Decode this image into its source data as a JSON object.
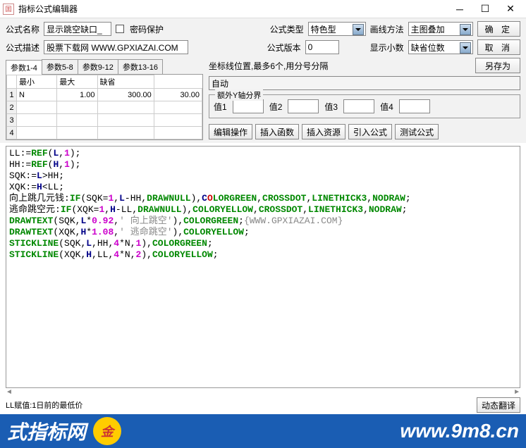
{
  "window": {
    "title": "指标公式编辑器"
  },
  "form": {
    "name_label": "公式名称",
    "name_value": "显示跳空缺口_",
    "pwd_label": "密码保护",
    "type_label": "公式类型",
    "type_value": "特色型",
    "draw_label": "画线方法",
    "draw_value": "主图叠加",
    "desc_label": "公式描述",
    "desc_value": "股票下载网 WWW.GPXIAZAI.COM",
    "ver_label": "公式版本",
    "ver_value": "0",
    "dec_label": "显示小数",
    "dec_value": "缺省位数"
  },
  "buttons": {
    "ok": "确  定",
    "cancel": "取  消",
    "saveas": "另存为",
    "edit_op": "编辑操作",
    "ins_func": "插入函数",
    "ins_res": "插入资源",
    "import": "引入公式",
    "test": "测试公式",
    "auto_trans": "动态翻译"
  },
  "tabs": [
    "参数1-4",
    "参数5-8",
    "参数9-12",
    "参数13-16"
  ],
  "param_headers": [
    "",
    "最小",
    "最大",
    "缺省"
  ],
  "param_rows": [
    {
      "idx": "1",
      "name": "N",
      "min": "1.00",
      "max": "300.00",
      "def": "30.00"
    },
    {
      "idx": "2",
      "name": "",
      "min": "",
      "max": "",
      "def": ""
    },
    {
      "idx": "3",
      "name": "",
      "min": "",
      "max": "",
      "def": ""
    },
    {
      "idx": "4",
      "name": "",
      "min": "",
      "max": "",
      "def": ""
    }
  ],
  "coord": {
    "label": "坐标线位置,最多6个,用分号分隔",
    "value": "自动"
  },
  "extra_y": {
    "legend": "额外Y轴分界",
    "labels": [
      "值1",
      "值2",
      "值3",
      "值4"
    ]
  },
  "code": [
    [
      [
        "LL",
        ""
      ],
      [
        ":=",
        "op"
      ],
      [
        "REF",
        "fn"
      ],
      [
        "(",
        "op"
      ],
      [
        "L",
        "kw"
      ],
      [
        ",",
        "op"
      ],
      [
        "1",
        "num"
      ],
      [
        ");",
        "op"
      ]
    ],
    [
      [
        "HH",
        ""
      ],
      [
        ":=",
        "op"
      ],
      [
        "REF",
        "fn"
      ],
      [
        "(",
        "op"
      ],
      [
        "H",
        "kw"
      ],
      [
        ",",
        "op"
      ],
      [
        "1",
        "num"
      ],
      [
        ");",
        "op"
      ]
    ],
    [
      [
        "SQK",
        ""
      ],
      [
        ":=",
        "op"
      ],
      [
        "L",
        "kw"
      ],
      [
        ">",
        "op"
      ],
      [
        "HH",
        ""
      ],
      [
        ";",
        "op"
      ]
    ],
    [
      [
        "XQK",
        ""
      ],
      [
        ":=",
        "op"
      ],
      [
        "H",
        "kw"
      ],
      [
        "<",
        "op"
      ],
      [
        "LL",
        ""
      ],
      [
        ";",
        "op"
      ]
    ],
    [
      [
        "向上跳几元钱",
        ""
      ],
      [
        ":",
        "op"
      ],
      [
        "IF",
        "fn"
      ],
      [
        "(",
        "op"
      ],
      [
        "SQK",
        ""
      ],
      [
        "=",
        "op"
      ],
      [
        "1",
        "num"
      ],
      [
        ",",
        "op"
      ],
      [
        "L",
        "kw"
      ],
      [
        "-",
        "op"
      ],
      [
        "HH",
        ""
      ],
      [
        ",",
        "op"
      ],
      [
        "DRAWNULL",
        "fn"
      ],
      [
        "),",
        "op"
      ],
      [
        "C",
        "kw"
      ],
      [
        "O",
        "red"
      ],
      [
        "LORGREEN",
        "fn"
      ],
      [
        ",",
        "op"
      ],
      [
        "CROSSDOT",
        "fn"
      ],
      [
        ",",
        "op"
      ],
      [
        "LINETHICK3",
        "fn"
      ],
      [
        ",",
        "op"
      ],
      [
        "NODRAW",
        "fn"
      ],
      [
        ";",
        "op"
      ]
    ],
    [
      [
        "逃命跳空元",
        ""
      ],
      [
        ":",
        "op"
      ],
      [
        "IF",
        "fn"
      ],
      [
        "(",
        "op"
      ],
      [
        "XQK",
        ""
      ],
      [
        "=",
        "op"
      ],
      [
        "1",
        "num"
      ],
      [
        ",",
        "op"
      ],
      [
        "H",
        "kw"
      ],
      [
        "-",
        "op"
      ],
      [
        "LL",
        ""
      ],
      [
        ",",
        "op"
      ],
      [
        "DRAWNULL",
        "fn"
      ],
      [
        "),",
        "op"
      ],
      [
        "COLORYELLOW",
        "fn"
      ],
      [
        ",",
        "op"
      ],
      [
        "CROSSDOT",
        "fn"
      ],
      [
        ",",
        "op"
      ],
      [
        "LINETHICK3",
        "fn"
      ],
      [
        ",",
        "op"
      ],
      [
        "NODRAW",
        "fn"
      ],
      [
        ";",
        "op"
      ]
    ],
    [
      [
        "DRAWTEXT",
        "fn"
      ],
      [
        "(",
        "op"
      ],
      [
        "SQK",
        ""
      ],
      [
        ",",
        "op"
      ],
      [
        "L",
        "kw"
      ],
      [
        "*",
        "op"
      ],
      [
        "0.92",
        "num"
      ],
      [
        ",",
        "op"
      ],
      [
        "' 向上跳空'",
        "str"
      ],
      [
        "),",
        "op"
      ],
      [
        "COLORGREEN",
        "fn"
      ],
      [
        ";",
        "op"
      ],
      [
        "{WWW.GPXIAZAI.COM}",
        "comment"
      ]
    ],
    [
      [
        "DRAWTEXT",
        "fn"
      ],
      [
        "(",
        "op"
      ],
      [
        "XQK",
        ""
      ],
      [
        ",",
        "op"
      ],
      [
        "H",
        "kw"
      ],
      [
        "*",
        "op"
      ],
      [
        "1.08",
        "num"
      ],
      [
        ",",
        "op"
      ],
      [
        "' 逃命跳空'",
        "str"
      ],
      [
        "),",
        "op"
      ],
      [
        "COLORYELLOW",
        "fn"
      ],
      [
        ";",
        "op"
      ]
    ],
    [
      [
        "STICKLINE",
        "fn"
      ],
      [
        "(",
        "op"
      ],
      [
        "SQK",
        ""
      ],
      [
        ",",
        "op"
      ],
      [
        "L",
        "kw"
      ],
      [
        ",",
        "op"
      ],
      [
        "HH",
        ""
      ],
      [
        ",",
        "op"
      ],
      [
        "4",
        "num"
      ],
      [
        "*",
        "op"
      ],
      [
        "N",
        ""
      ],
      [
        ",",
        "op"
      ],
      [
        "1",
        "num"
      ],
      [
        "),",
        "op"
      ],
      [
        "COLORGREEN",
        "fn"
      ],
      [
        ";",
        "op"
      ]
    ],
    [
      [
        "STICKLINE",
        "fn"
      ],
      [
        "(",
        "op"
      ],
      [
        "XQK",
        ""
      ],
      [
        ",",
        "op"
      ],
      [
        "H",
        "kw"
      ],
      [
        ",",
        "op"
      ],
      [
        "LL",
        ""
      ],
      [
        ",",
        "op"
      ],
      [
        "4",
        "num"
      ],
      [
        "*",
        "op"
      ],
      [
        "N",
        ""
      ],
      [
        ",",
        "op"
      ],
      [
        "2",
        "num"
      ],
      [
        "),",
        "op"
      ],
      [
        "COLORYELLOW",
        "fn"
      ],
      [
        ";",
        "op"
      ]
    ]
  ],
  "status": "LL赋值:1日前的最低价",
  "banner": {
    "left": "式指标网",
    "url": "www.9m8.cn"
  }
}
